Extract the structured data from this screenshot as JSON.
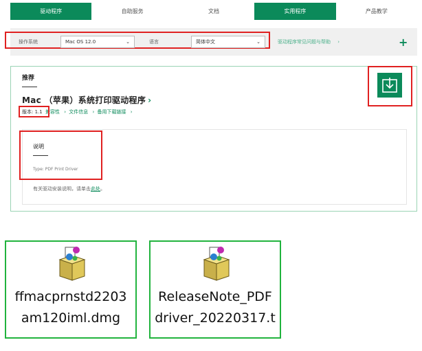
{
  "nav": {
    "tabs": [
      {
        "label": "驱动程序",
        "active": true
      },
      {
        "label": "自助服务",
        "active": false
      },
      {
        "label": "文档",
        "active": false
      },
      {
        "label": "实用程序",
        "active": true
      },
      {
        "label": "产品教学",
        "active": false
      }
    ]
  },
  "filter": {
    "os_label": "操作系统",
    "os_value": "Mac OS 12.0",
    "lang_label": "语言",
    "lang_value": "简体中文",
    "help_link": "驱动程序常见问题与帮助",
    "help_chevron": "›",
    "plus": "+"
  },
  "card": {
    "heading": "推荐",
    "product_title": "Mac （苹果）系统打印驱动程序",
    "product_chevron": "›",
    "version": "版本: 1.1",
    "links": [
      "兼容性",
      "文件信息",
      "备用下载链接"
    ],
    "link_chevron": "›",
    "desc_heading": "说明",
    "desc_type": "Type: PDF Print Driver",
    "note_text": "有关驱动安装说明，请单击",
    "note_link": "此处",
    "note_end": "。"
  },
  "files": [
    {
      "line1": "ffmacprnstd2203",
      "line2": "am120iml.dmg"
    },
    {
      "line1": "ReleaseNote_PDF",
      "line2": "driver_20220317.t"
    }
  ],
  "colors": {
    "brand_green": "#0b8a5a",
    "highlight_red": "#e02020",
    "file_border": "#20b33d"
  },
  "icons": [
    "download-icon",
    "installer-package-icon"
  ]
}
